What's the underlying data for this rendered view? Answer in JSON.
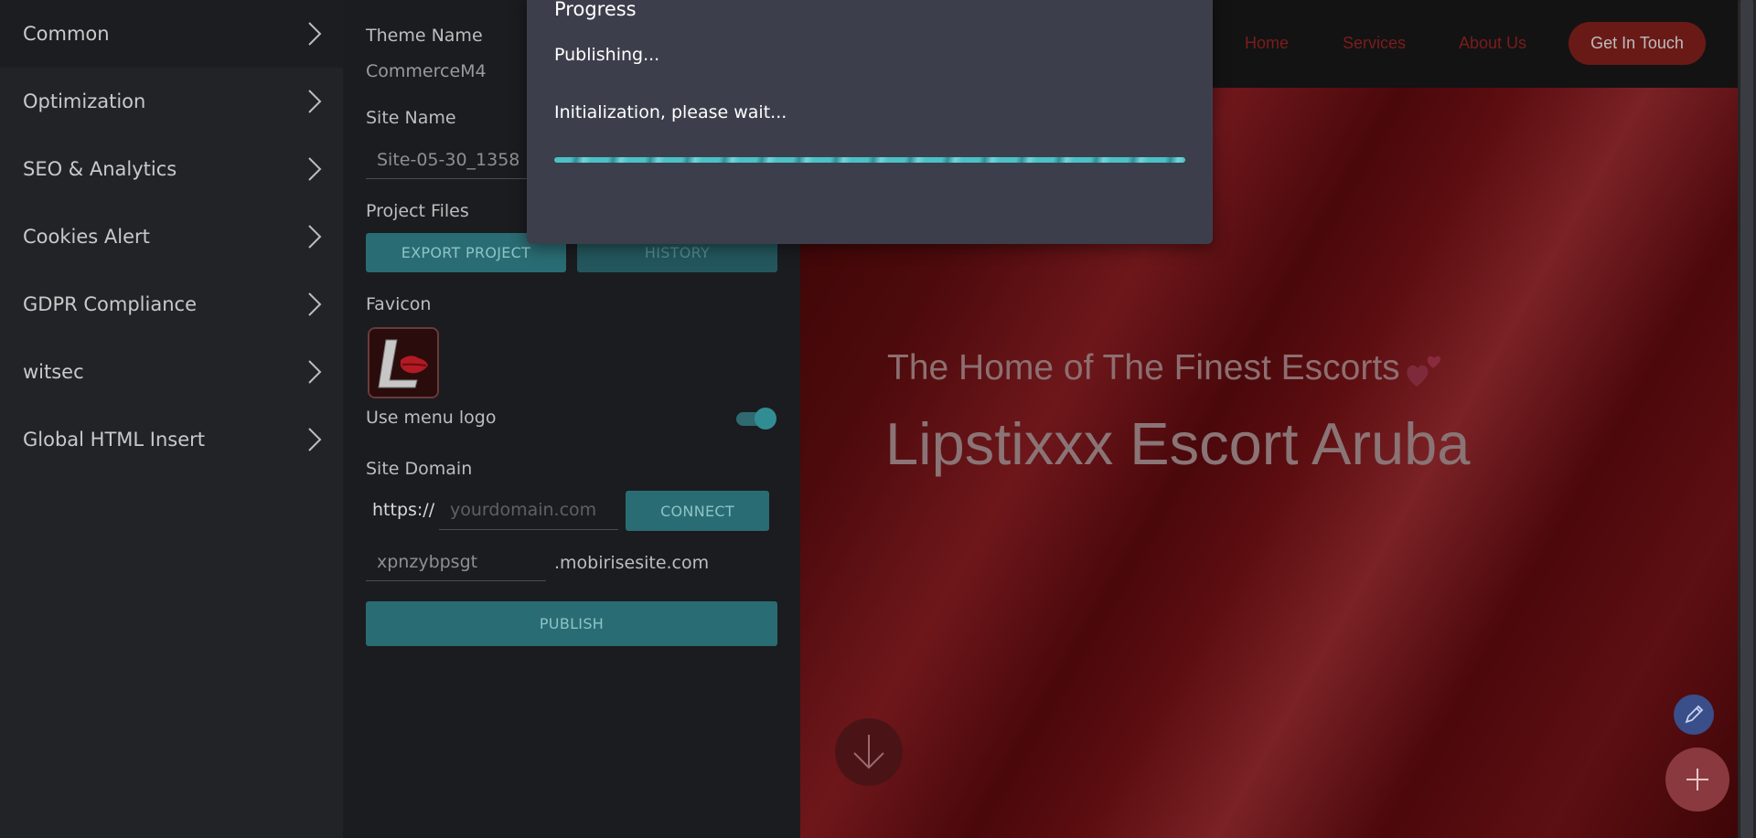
{
  "sidebar": {
    "items": [
      {
        "label": "Common"
      },
      {
        "label": "Optimization"
      },
      {
        "label": "SEO & Analytics"
      },
      {
        "label": "Cookies Alert"
      },
      {
        "label": "GDPR Compliance"
      },
      {
        "label": "witsec"
      },
      {
        "label": "Global HTML Insert"
      }
    ]
  },
  "panel": {
    "theme_name_label": "Theme Name",
    "theme_name_value": "CommerceM4",
    "site_name_label": "Site Name",
    "site_name_value": "Site-05-30_1358",
    "project_files_label": "Project Files",
    "export_button": "EXPORT PROJECT",
    "history_button": "HISTORY",
    "favicon_label": "Favicon",
    "use_menu_logo_label": "Use menu logo",
    "use_menu_logo_on": true,
    "site_domain_label": "Site Domain",
    "protocol_prefix": "https://",
    "domain_placeholder": "yourdomain.com",
    "connect_button": "CONNECT",
    "subdomain_value": "xpnzybpsgt",
    "subdomain_suffix": ".mobirisesite.com",
    "publish_button": "PUBLISH"
  },
  "modal": {
    "title": "Progress",
    "status": "Publishing...",
    "message": "Initialization, please wait...",
    "progress": 1.0
  },
  "preview": {
    "nav": {
      "links": [
        "Home",
        "Services",
        "About Us"
      ],
      "cta": "Get In Touch"
    },
    "hero": {
      "subtitle": "The Home of The Finest Escorts",
      "title": "Lipstixxx Escort Aruba"
    }
  },
  "colors": {
    "teal_button": "#2a6c73",
    "modal_bg": "#3c3f4b",
    "progress": "#4cc0c6",
    "nav_link": "#7c1c1c",
    "cta_bg": "#6a1a16"
  }
}
